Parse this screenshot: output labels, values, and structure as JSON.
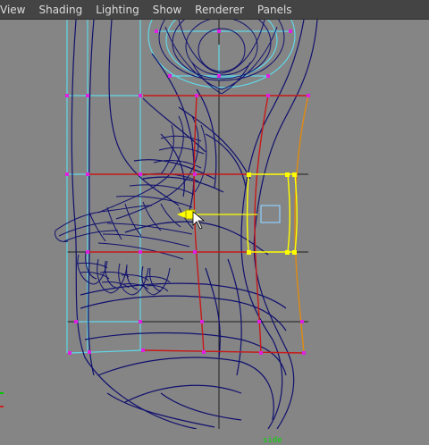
{
  "menu": {
    "items": [
      "View",
      "Shading",
      "Lighting",
      "Show",
      "Renderer",
      "Panels"
    ]
  },
  "viewport": {
    "camera_label": "side",
    "colors": {
      "background": "#858585",
      "mesh_wire": "#10106e",
      "grid_axis": "#1a1a1a",
      "cage_cyan": "#5fd8e8",
      "vertex_magenta": "#e020e0",
      "cage_selected": "#ffff00",
      "cage_orange": "#e08a10",
      "cage_red": "#c81818",
      "manipulator": "#ffff00",
      "rect_marker": "#8fd0ff"
    }
  }
}
